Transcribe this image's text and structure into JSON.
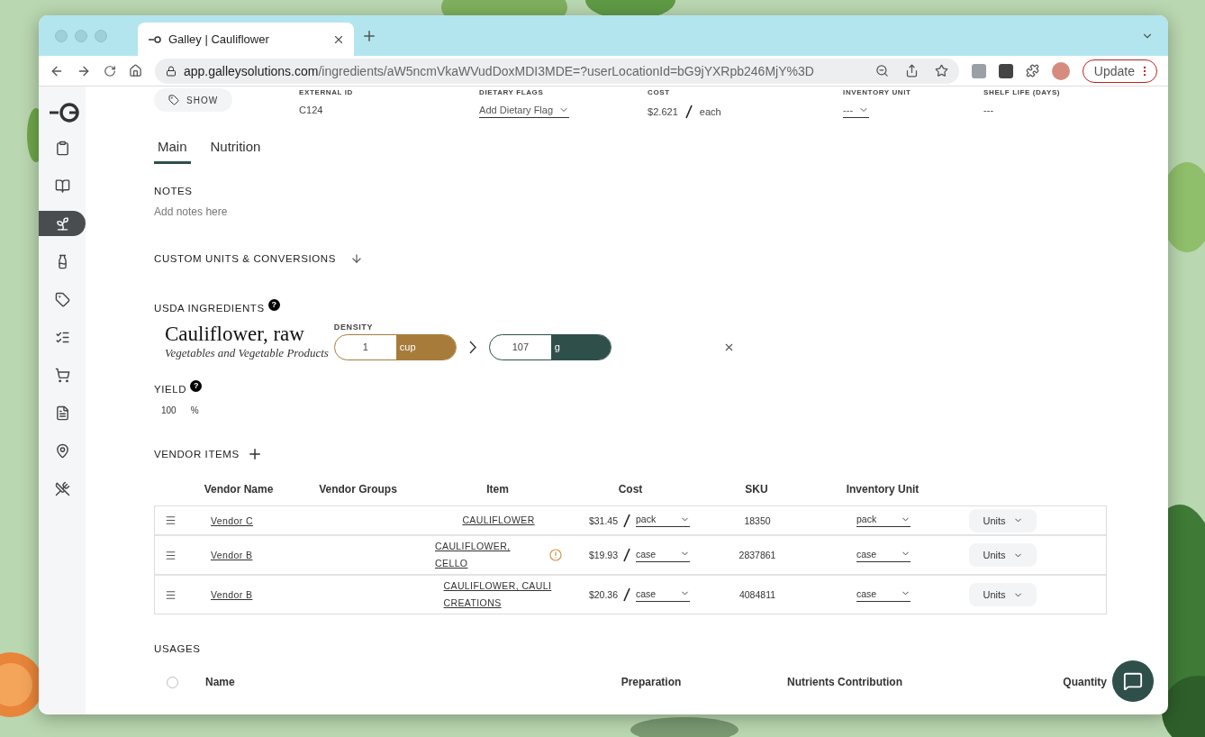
{
  "browser": {
    "tab_title": "Galley | Cauliflower",
    "url": {
      "host": "app.galleysolutions.com",
      "path": "/ingredients/aW5ncmVkaWVudDoxMDI3MDE=?userLocationId=bG9jYXRpb246MjY%3D"
    },
    "update_label": "Update"
  },
  "sidebar": {
    "items": [
      {
        "selected": false
      },
      {
        "selected": false
      },
      {
        "selected": true
      },
      {
        "selected": false
      },
      {
        "selected": false
      },
      {
        "selected": false
      },
      {
        "selected": false
      },
      {
        "selected": false
      },
      {
        "selected": false
      },
      {
        "selected": false
      }
    ]
  },
  "header_fields": {
    "show_button": "SHOW",
    "fields": [
      {
        "kind": "text",
        "label": "EXTERNAL ID",
        "value": "C124"
      },
      {
        "kind": "select",
        "label": "DIETARY FLAGS",
        "value": "Add Dietary Flag"
      },
      {
        "kind": "cost",
        "label": "COST",
        "value": "$2.621",
        "unit": "each"
      },
      {
        "kind": "select",
        "label": "INVENTORY UNIT",
        "value": "---"
      },
      {
        "kind": "text",
        "label": "SHELF LIFE (DAYS)",
        "value": "---"
      }
    ]
  },
  "tabs": [
    {
      "label": "Main",
      "selected": true
    },
    {
      "label": "Nutrition",
      "selected": false
    }
  ],
  "notes": {
    "title": "NOTES",
    "placeholder": "Add notes here"
  },
  "custom_units": {
    "title": "CUSTOM UNITS & CONVERSIONS"
  },
  "usda": {
    "title": "USDA INGREDIENTS",
    "help": "?",
    "name": "Cauliflower, raw",
    "category": "Vegetables and Vegetable Products",
    "density_label": "DENSITY",
    "from": {
      "value": "1",
      "unit": "cup",
      "color": "#a77c3b"
    },
    "to": {
      "value": "107",
      "unit": "g",
      "color": "#2f4f4b"
    }
  },
  "yield": {
    "title": "YIELD",
    "help": "?",
    "value": "100",
    "unit": "%"
  },
  "vendor_items": {
    "title": "VENDOR ITEMS",
    "columns": [
      "Vendor Name",
      "Vendor Groups",
      "Item",
      "Cost",
      "SKU",
      "Inventory Unit"
    ],
    "rows": [
      {
        "vendor": "Vendor C",
        "item": "CAULIFLOWER",
        "warning": false,
        "cost": "$31.45",
        "cost_unit": "pack",
        "sku": "18350",
        "inventory_unit": "pack",
        "units_button": "Units"
      },
      {
        "vendor": "Vendor B",
        "item": "CAULIFLOWER, CELLO",
        "warning": true,
        "cost": "$19.93",
        "cost_unit": "case",
        "sku": "2837861",
        "inventory_unit": "case",
        "units_button": "Units"
      },
      {
        "vendor": "Vendor B",
        "item": "CAULIFLOWER, CAULI CREATIONS",
        "warning": false,
        "cost": "$20.36",
        "cost_unit": "case",
        "sku": "4084811",
        "inventory_unit": "case",
        "units_button": "Units"
      }
    ]
  },
  "usages": {
    "title": "USAGES",
    "select_all": false,
    "columns": [
      "Name",
      "Preparation",
      "Nutrients Contribution",
      "Quantity"
    ]
  }
}
